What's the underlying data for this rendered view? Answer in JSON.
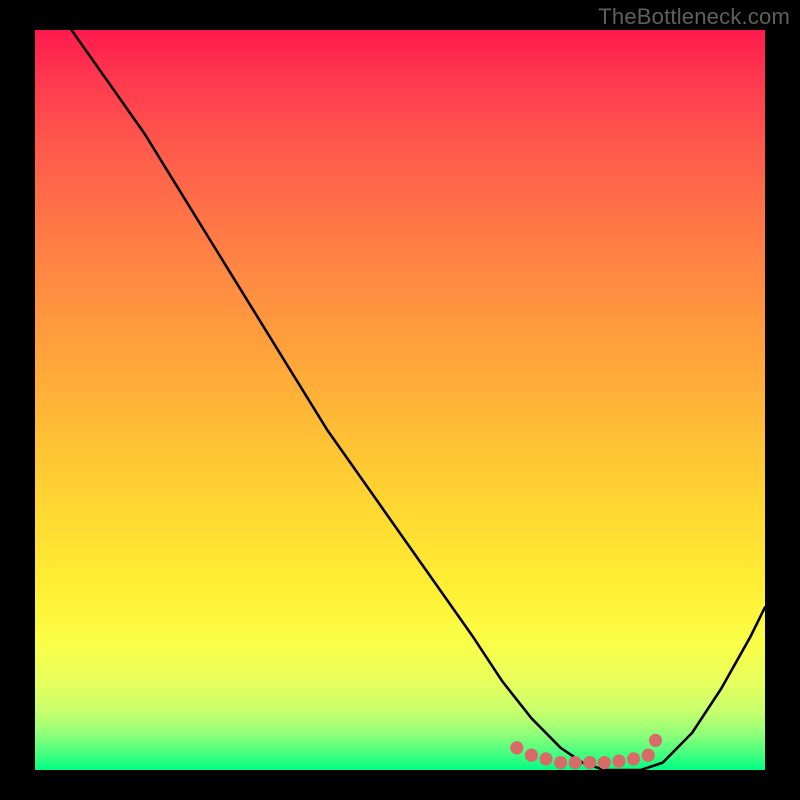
{
  "watermark": "TheBottleneck.com",
  "chart_data": {
    "type": "line",
    "title": "",
    "xlabel": "",
    "ylabel": "",
    "xlim": [
      0,
      100
    ],
    "ylim": [
      0,
      100
    ],
    "grid": false,
    "series": [
      {
        "name": "curve",
        "x": [
          5,
          10,
          15,
          20,
          25,
          30,
          35,
          40,
          45,
          50,
          55,
          60,
          64,
          68,
          72,
          75,
          78,
          80,
          83,
          86,
          90,
          94,
          98,
          100
        ],
        "values": [
          100,
          93,
          86,
          78,
          70,
          62,
          54,
          46,
          39,
          32,
          25,
          18,
          12,
          7,
          3,
          1,
          0,
          0,
          0,
          1,
          5,
          11,
          18,
          22
        ]
      }
    ],
    "markers": {
      "name": "highlight-points",
      "color": "#d86a6a",
      "x": [
        66,
        68,
        70,
        72,
        74,
        76,
        78,
        80,
        82,
        84,
        85
      ],
      "values": [
        3,
        2,
        1.5,
        1,
        1,
        1,
        1,
        1.2,
        1.5,
        2,
        4
      ]
    }
  }
}
